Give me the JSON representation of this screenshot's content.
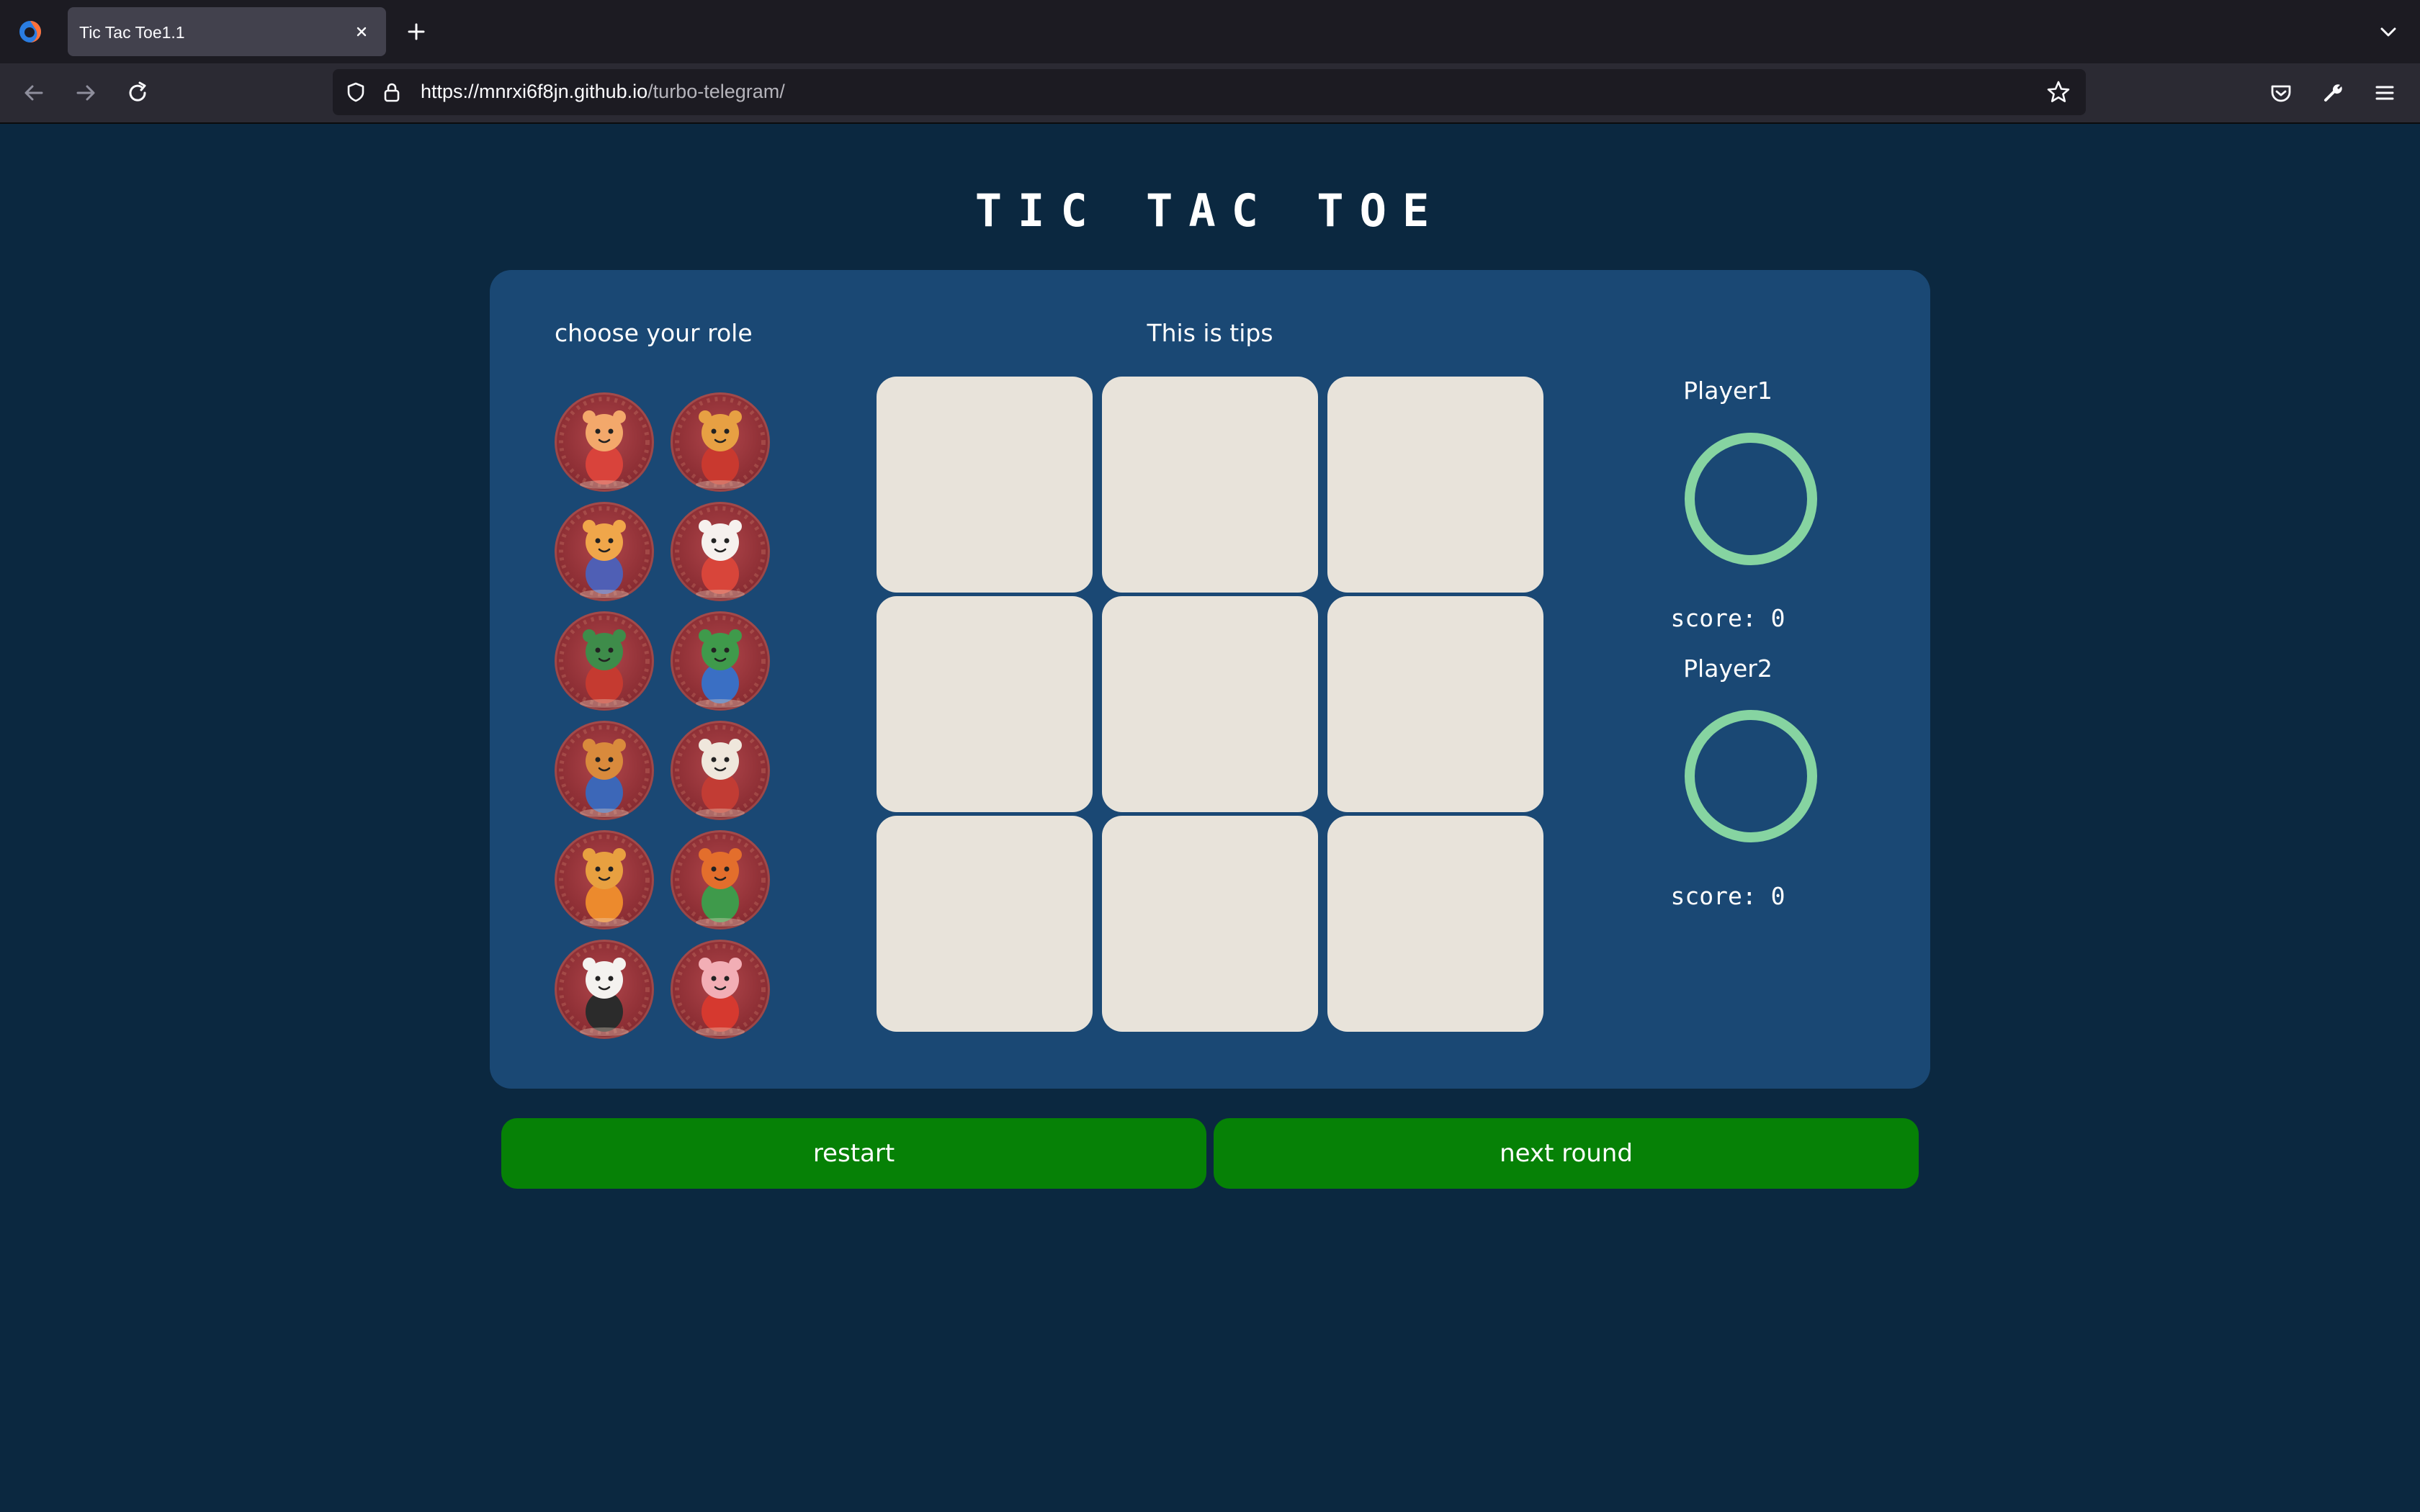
{
  "browser": {
    "tab_title": "Tic Tac Toe1.1",
    "url_host": "https://mnrxi6f8jn.github.io",
    "url_path": "/turbo-telegram/"
  },
  "game": {
    "title": "TIC TAC TOE",
    "role_heading": "choose your role",
    "tips": "This is tips",
    "roles": [
      "rat",
      "ox",
      "tiger",
      "rabbit",
      "dragon",
      "snake",
      "horse",
      "goat",
      "monkey",
      "rooster",
      "dog",
      "pig"
    ],
    "board": [
      "",
      "",
      "",
      "",
      "",
      "",
      "",
      "",
      ""
    ],
    "players": [
      {
        "name": "Player1",
        "score_text": "score: 0"
      },
      {
        "name": "Player2",
        "score_text": "score: 0"
      }
    ],
    "restart_label": "restart",
    "next_round_label": "next round"
  },
  "colors": {
    "page_bg": "#0b2840",
    "panel_bg": "#1a4874",
    "cell_bg": "#e8e3da",
    "ring": "#86d4a1",
    "button_bg": "#068106"
  }
}
